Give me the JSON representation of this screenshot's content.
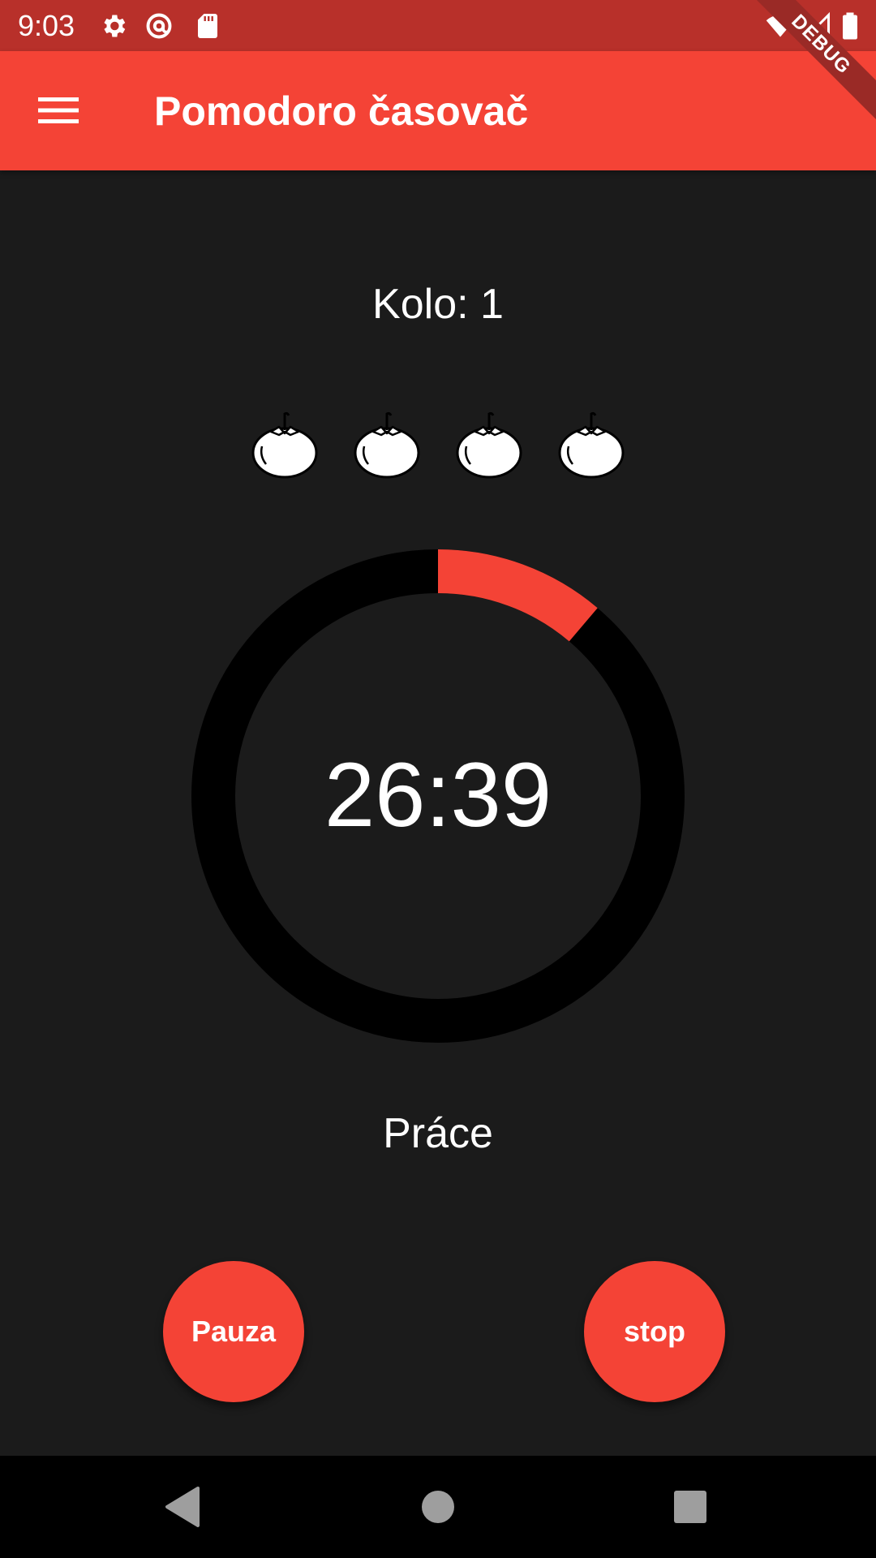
{
  "status_bar": {
    "time": "9:03",
    "icons": [
      "gear-icon",
      "at-sign-icon",
      "sd-card-icon",
      "wifi-icon",
      "signal-icon",
      "battery-icon"
    ]
  },
  "debug_banner": {
    "label": "DEBUG"
  },
  "app_bar": {
    "menu_icon": "menu-icon",
    "title": "Pomodoro časovač"
  },
  "round": {
    "label": "Kolo: 1"
  },
  "tomatoes": {
    "count": 4,
    "icon": "tomato-icon"
  },
  "timer": {
    "time": "26:39",
    "progress": 0.112,
    "progress_color": "#f44336",
    "track_color": "#000000"
  },
  "phase": {
    "label": "Práce"
  },
  "buttons": {
    "pause_label": "Pauza",
    "stop_label": "stop"
  },
  "nav_bar": {
    "icons": [
      "back-icon",
      "home-icon",
      "recents-icon"
    ]
  },
  "colors": {
    "accent": "#f44336",
    "status_bar": "#b8302a",
    "background": "#1b1b1b"
  }
}
